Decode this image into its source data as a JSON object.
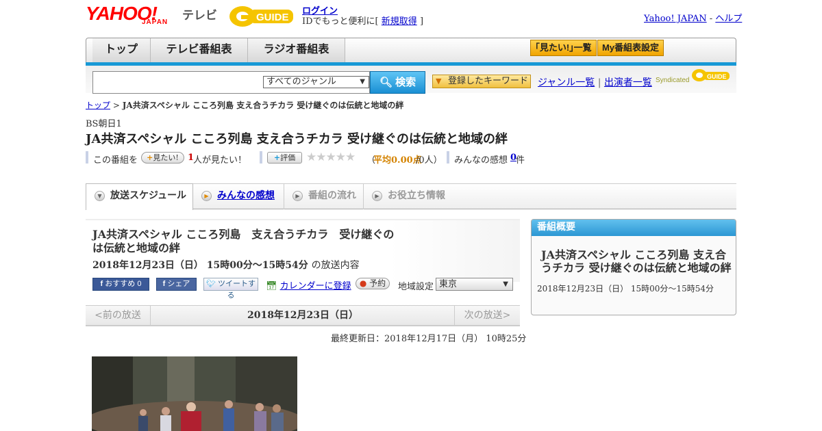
{
  "header": {
    "logo_text": "YAHOO!",
    "logo_sub": "JAPAN",
    "service_name": "テレビ",
    "gguide_logo": "GUIDE",
    "login_link": "ログイン",
    "login_text": "IDでもっと便利に[",
    "signup_link": "新規取得",
    "signup_close": "]",
    "yahoo_link": "Yahoo! JAPAN",
    "sep": "-",
    "help_link": "ヘルプ"
  },
  "nav": {
    "tabs": [
      {
        "label": "トップ"
      },
      {
        "label": "テレビ番組表"
      },
      {
        "label": "ラジオ番組表"
      }
    ],
    "mitai_list": "｢見たい!｣一覧",
    "my_schedule": "My番組表設定"
  },
  "search": {
    "genre_select": "すべてのジャンル",
    "search_button": "検索",
    "keyword_button": "登録したキーワード",
    "genre_list": "ジャンル一覧",
    "divider": "|",
    "performer_list": "出演者一覧",
    "syndicated": "Syndicated"
  },
  "breadcrumb": {
    "top": "トップ",
    "sep": ">",
    "current": "JA共済スペシャル こころ列島 支え合うチカラ 受け継ぐのは伝統と地域の絆"
  },
  "program": {
    "station": "BS朝日1",
    "title": "JA共済スペシャル こころ列島 支え合うチカラ 受け継ぐのは伝統と地域の絆",
    "this_program": "この番組を",
    "mitai_button": "見たい!",
    "mitai_count": "1",
    "mitai_suffix": "人が見たい！",
    "rate_button": "評価",
    "stars": "★★★★★",
    "avg_open": "（",
    "avg_label": "平均0.00点",
    "avg_count": "/0人）",
    "comments_label": "みんなの感想",
    "comments_count": "0",
    "comments_suffix": "件"
  },
  "tabs": [
    {
      "label": "放送スケジュール"
    },
    {
      "label": "みんなの感想"
    },
    {
      "label": "番組の流れ"
    },
    {
      "label": "お役立ち情報"
    }
  ],
  "schedule": {
    "title": "JA共済スペシャル こころ列島　支え合うチカラ　受け継ぐのは伝統と地域の絆",
    "date_time": "2018年12月23日（日） 15時00分～15時54分",
    "date_suffix": "の放送内容",
    "fb_recommend": "おすすめ 0",
    "fb_share": "シェア",
    "tweet": "ツイートする",
    "calendar": "カレンダーに登録",
    "reserve": "予約",
    "area_label": "地域設定",
    "area_value": "東京",
    "prev": "<前の放送",
    "current_date": "2018年12月23日（日）",
    "next": "次の放送>",
    "updated": "最終更新日：2018年12月17日（月） 10時25分"
  },
  "overview": {
    "header": "番組概要",
    "title": "JA共済スペシャル こころ列島 支え合うチカラ 受け継ぐのは伝統と地域の絆",
    "date_time": "2018年12月23日（日） 15時00分～15時54分"
  },
  "colors": {
    "accent_blue": "#1899d6",
    "brand_red": "#ff0000",
    "gguide_yellow": "#f5c400"
  }
}
